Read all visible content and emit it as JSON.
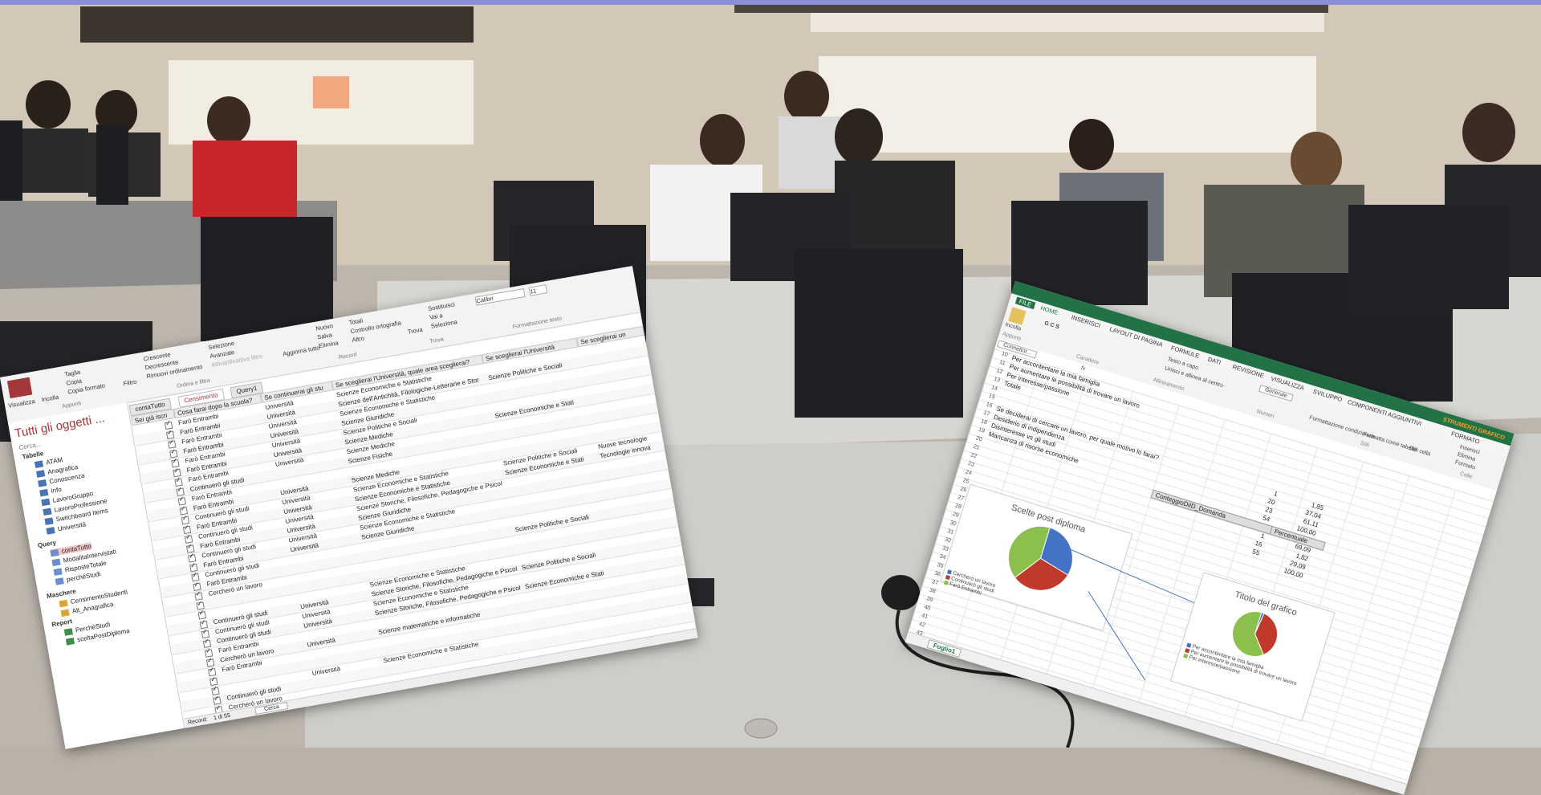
{
  "photo": {
    "description_colors": {
      "wall": "#cfc4b4",
      "floor": "#a9a196",
      "desk": "#d6d4d0",
      "monitor": "#26282b",
      "top_stripe": "#8b8fd6"
    }
  },
  "access": {
    "ribbon": {
      "view": "Visualizza",
      "paste": "Incolla",
      "cut": "Taglia",
      "copy": "Copia",
      "format_painter": "Copia formato",
      "clipboard": "Appunti",
      "filter": "Filtro",
      "ascending": "Crescente",
      "descending": "Decrescente",
      "remove_sort": "Rimuovi ordinamento",
      "selection": "Selezione",
      "advanced": "Avanzate",
      "toggle_filter": "Attiva/disattiva filtro",
      "sort_filter": "Ordina e filtra",
      "refresh": "Aggiorna tutto",
      "new": "Nuovo",
      "save": "Salva",
      "delete": "Elimina",
      "totals": "Totali",
      "spelling": "Controllo ortografia",
      "more": "Altro",
      "records": "Record",
      "find": "Trova",
      "replace": "Sostituisci",
      "goto": "Vai a",
      "select": "Seleziona",
      "find_group": "Trova",
      "font": "Calibri",
      "font_size": "11",
      "text_format": "Formattazione testo"
    },
    "nav": {
      "title": "Tutti gli oggetti ...",
      "search": "Cerca...",
      "sections": {
        "tables": "Tabelle",
        "queries": "Query",
        "forms": "Maschere",
        "reports": "Report"
      },
      "tables": [
        "ATAM",
        "Anagrafica",
        "Conoscenza",
        "Info",
        "LavoroGruppo",
        "LavoroProfessione",
        "Switchboard Items",
        "Università"
      ],
      "queries": [
        "contaTutto",
        "ModalitaIntervistati",
        "RisposteTotale",
        "perchéStudi"
      ],
      "forms": [
        "CensimentoStudenti",
        "Alt_Anagrafica"
      ],
      "reports": [
        "PerchéStudi",
        "sceltaPostDiploma"
      ]
    },
    "tabs": [
      "contaTutto",
      "Censimento",
      "Query1"
    ],
    "columns": [
      "Sei già iscri",
      "Cosa farai dopo la scuola?",
      "Se continuerai gli stu",
      "Se sceglierai l'Università, quale area sceglierai?",
      "Se sceglierai l'Università",
      "Se sceglierai un",
      "Tecnologie innova"
    ],
    "rows": [
      {
        "c": true,
        "a": "Farò Entrambi",
        "b": "Università",
        "d": "Scienze Economiche e Statistiche",
        "e": "",
        "f": ""
      },
      {
        "c": true,
        "a": "Farò Entrambi",
        "b": "Università",
        "d": "Scienze dell'Antichità, Filologiche-Letterarie e Stor",
        "e": "Scienze Politiche e Sociali",
        "f": ""
      },
      {
        "c": true,
        "a": "Farò Entrambi",
        "b": "Università",
        "d": "Scienze Economiche e Statistiche",
        "e": "",
        "f": ""
      },
      {
        "c": true,
        "a": "Farò Entrambi",
        "b": "Università",
        "d": "Scienze Giuridiche",
        "e": "",
        "f": ""
      },
      {
        "c": true,
        "a": "Farò Entrambi",
        "b": "Università",
        "d": "Scienze Politiche e Sociali",
        "e": "",
        "f": ""
      },
      {
        "c": true,
        "a": "Farò Entrambi",
        "b": "Università",
        "d": "Scienze Mediche",
        "e": "Scienze Economiche e Stati",
        "f": ""
      },
      {
        "c": true,
        "a": "Farò Entrambi",
        "b": "Università",
        "d": "Scienze Mediche",
        "e": "",
        "f": ""
      },
      {
        "c": true,
        "a": "Continuerò gli studi",
        "b": "",
        "d": "Scienze Fisiche",
        "e": "",
        "f": ""
      },
      {
        "c": true,
        "a": "Farò Entrambi",
        "b": "",
        "d": "",
        "e": "",
        "f": ""
      },
      {
        "c": true,
        "a": "Farò Entrambi",
        "b": "Università",
        "d": "Scienze Mediche",
        "e": "",
        "f": ""
      },
      {
        "c": true,
        "a": "Continuerò gli studi",
        "b": "Università",
        "d": "Scienze Economiche e Statistiche",
        "e": "Scienze Politiche e Sociali",
        "f": "Nuove tecnologie"
      },
      {
        "c": true,
        "a": "Farò Entrambi",
        "b": "Università",
        "d": "Scienze Economiche e Statistiche",
        "e": "Scienze Economiche e Stati",
        "f": "Tecnologie innova"
      },
      {
        "c": true,
        "a": "Continuerò gli studi",
        "b": "Università",
        "d": "Scienze Storiche, Filosofiche, Pedagogiche e Psicol",
        "e": "",
        "f": ""
      },
      {
        "c": true,
        "a": "Farò Entrambi",
        "b": "Università",
        "d": "Scienze Giuridiche",
        "e": "",
        "f": ""
      },
      {
        "c": true,
        "a": "Continuerò gli studi",
        "b": "Università",
        "d": "Scienze Economiche e Statistiche",
        "e": "",
        "f": ""
      },
      {
        "c": true,
        "a": "Farò Entrambi",
        "b": "Università",
        "d": "Scienze Giuridiche",
        "e": "",
        "f": ""
      },
      {
        "c": true,
        "a": "Continuerò gli studi",
        "b": "",
        "d": "",
        "e": "",
        "f": ""
      },
      {
        "c": true,
        "a": "Farò Entrambi",
        "b": "",
        "d": "",
        "e": "Scienze Politiche e Sociali",
        "f": ""
      },
      {
        "c": true,
        "a": "Cercherò un lavoro",
        "b": "",
        "d": "",
        "e": "",
        "f": ""
      },
      {
        "c": true,
        "a": "",
        "b": "",
        "d": "",
        "e": "",
        "f": ""
      },
      {
        "c": true,
        "a": "",
        "b": "",
        "d": "Scienze Economiche e Statistiche",
        "e": "",
        "f": ""
      },
      {
        "c": true,
        "a": "Continuerò gli studi",
        "b": "Università",
        "d": "Scienze Storiche, Filosofiche, Pedagogiche e Psicol",
        "e": "Scienze Politiche e Sociali",
        "f": ""
      },
      {
        "c": true,
        "a": "Continuerò gli studi",
        "b": "Università",
        "d": "Scienze Economiche e Statistiche",
        "e": "",
        "f": ""
      },
      {
        "c": true,
        "a": "Continuerò gli studi",
        "b": "Università",
        "d": "Scienze Storiche, Filosofiche, Pedagogiche e Psicol",
        "e": "Scienze Economiche e Stati",
        "f": ""
      },
      {
        "c": true,
        "a": "Farò Entrambi",
        "b": "",
        "d": "",
        "e": "",
        "f": ""
      },
      {
        "c": true,
        "a": "Cercherò un lavoro",
        "b": "Università",
        "d": "Scienze matematiche e informatiche",
        "e": "",
        "f": ""
      },
      {
        "c": true,
        "a": "Farò Entrambi",
        "b": "",
        "d": "",
        "e": "",
        "f": ""
      },
      {
        "c": true,
        "a": "",
        "b": "",
        "d": "",
        "e": "",
        "f": ""
      },
      {
        "c": true,
        "a": "",
        "b": "Università",
        "d": "Scienze Economiche e Statistiche",
        "e": "",
        "f": ""
      },
      {
        "c": true,
        "a": "Continuerò gli studi",
        "b": "",
        "d": "",
        "e": "",
        "f": ""
      },
      {
        "c": true,
        "a": "Cercherò un lavoro",
        "b": "",
        "d": "",
        "e": "",
        "f": ""
      },
      {
        "c": true,
        "a": "Cercherò un lavoro",
        "b": "Università",
        "d": "",
        "e": "",
        "f": ""
      },
      {
        "c": true,
        "a": "",
        "b": "",
        "d": "",
        "e": "",
        "f": ""
      },
      {
        "c": true,
        "a": "Farò Entrambi",
        "b": "",
        "d": "",
        "e": "",
        "f": ""
      }
    ],
    "status": {
      "record_label": "Record:",
      "record_pos": "1 di 55",
      "search": "Cerca"
    }
  },
  "excel": {
    "tabs": [
      "FILE",
      "HOME",
      "INSERISCI",
      "LAYOUT DI PAGINA",
      "FORMULE",
      "DATI",
      "REVISIONE",
      "VISUALIZZA",
      "SVILUPPO",
      "COMPONENTI AGGIUNTIVI",
      "STRUMENTI GRAFICO",
      "FORMATO"
    ],
    "ribbon": {
      "paste": "Incolla",
      "clipboard": "Appunti",
      "font": "Carattere",
      "align": "Allineamento",
      "wrap": "Testo a capo",
      "merge": "Unisci e allinea al centro",
      "numbers": "Numeri",
      "general": "Generale",
      "cond_format": "Formattazione condizionale",
      "format_table": "Formatta come tabella",
      "cell_styles": "Stili cella",
      "styles": "Stili",
      "insert": "Inserisci",
      "delete": "Elimina",
      "format": "Formato",
      "cells": "Celle",
      "name_box": "Connettor...",
      "fx": "fx"
    },
    "cells": [
      {
        "r": "10",
        "t": "Per accontentare la mia famiglia"
      },
      {
        "r": "11",
        "t": "Per aumentare le possibilità di trovare un lavoro"
      },
      {
        "r": "12",
        "t": "Per interesse/passione"
      },
      {
        "r": "13",
        "t": "Totale"
      },
      {
        "r": "14",
        "t": ""
      },
      {
        "r": "15",
        "t": ""
      },
      {
        "r": "16",
        "t": "Se deciderai di cercare un lavoro, per quale motivo lo farai?"
      },
      {
        "r": "17",
        "t": "Desiderio di indipendenza"
      },
      {
        "r": "18",
        "t": "Disinteresse vs gli studi"
      },
      {
        "r": "19",
        "t": "Mancanza di risorse economiche"
      }
    ],
    "col_header_b": "ConteggioDiID_Domanda",
    "col_header_c": "Percentuale",
    "values": [
      "1",
      "20",
      "23",
      "54",
      "",
      "1",
      "16",
      "55"
    ],
    "percents": [
      "1,85",
      "37,04",
      "61,11",
      "100,00",
      "",
      "69,09",
      "1,82",
      "29,09",
      "100,00"
    ],
    "row_numbers": [
      "20",
      "21",
      "22",
      "23",
      "24",
      "25",
      "26",
      "27",
      "28",
      "29",
      "30",
      "31",
      "32",
      "33",
      "34",
      "35",
      "36",
      "37",
      "38",
      "39",
      "40",
      "41",
      "42",
      "43"
    ],
    "chart1": {
      "title": "Scelte post diploma",
      "legend": [
        "Cercherò un lavoro",
        "Continuerò gli studi",
        "Farò Entrambi"
      ],
      "colors": [
        "#4472c4",
        "#c0392b",
        "#8cbf4e"
      ]
    },
    "chart2": {
      "title": "Titolo del grafico",
      "legend": [
        "Per accontentare la mia famiglia",
        "Per aumentare le possibilità di trovare un lavoro",
        "Per interesse/passione"
      ],
      "colors": [
        "#4472c4",
        "#c0392b",
        "#8cbf4e"
      ]
    },
    "sheet_tab": "Foglio1"
  }
}
